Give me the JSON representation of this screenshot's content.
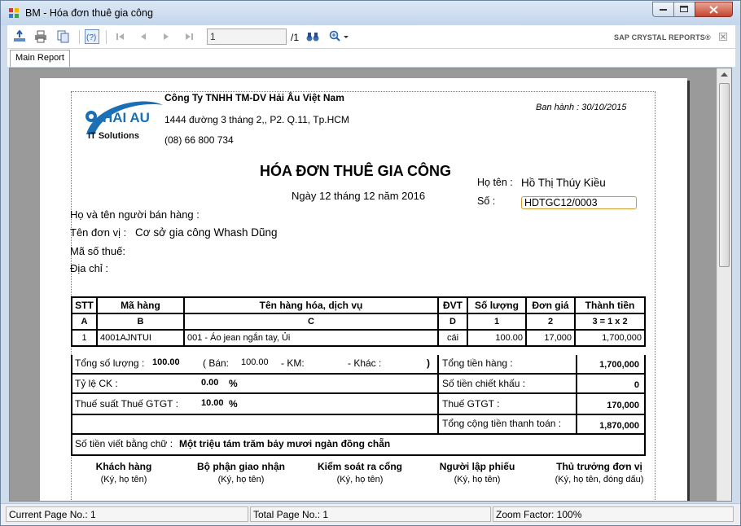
{
  "window": {
    "title": "BM - Hóa đơn thuê gia công"
  },
  "toolbar": {
    "page_value": "1",
    "page_total": "/1",
    "brand": "SAP CRYSTAL REPORTS®"
  },
  "tabs": [
    {
      "label": "Main Report"
    }
  ],
  "report": {
    "company_name": "Công Ty TNHH TM-DV Hải Âu Việt Nam",
    "company_address": "1444 đường 3 tháng 2,, P2. Q.11, Tp.HCM",
    "company_phone": "(08) 66 800 734",
    "logo_text": "HAI AU",
    "logo_sub": "IT Solutions",
    "issued": "Ban hành : 30/10/2015",
    "title": "HÓA ĐƠN THUÊ GIA CÔNG",
    "date": "Ngày 12 tháng 12 năm 2016",
    "name_label": "Họ tên :",
    "name_value": "Hồ Thị Thúy Kiều",
    "no_label": "Số :",
    "no_value": "HDTGC12/0003",
    "seller_label": "Họ và tên người bán hàng :",
    "unit_label": "Tên đơn vị :",
    "unit_value": "Cơ sở gia công Whash Dũng",
    "tax_code_label": "Mã số thuế:",
    "address_label": "Địa chỉ :"
  },
  "table": {
    "headers": [
      "STT",
      "Mã hàng",
      "Tên hàng hóa, dịch vụ",
      "ĐVT",
      "Số lượng",
      "Đơn giá",
      "Thành tiền"
    ],
    "subheaders": [
      "A",
      "B",
      "C",
      "D",
      "1",
      "2",
      "3 = 1 x 2"
    ],
    "rows": [
      [
        "1",
        "4001AJNTUI",
        "001 - Áo jean ngắn tay, Ủi",
        "cái",
        "100.00",
        "17,000",
        "1,700,000"
      ]
    ]
  },
  "summary": {
    "total_qty_label": "Tổng số lượng :",
    "total_qty": "100.00",
    "sale_label": "( Bán:",
    "sale_value": "100.00",
    "km_label": "- KM:",
    "other_label": "- Khác :",
    "close_paren": ")",
    "total_goods_label": "Tổng tiền hàng :",
    "total_goods": "1,700,000",
    "discount_rate_label": "Tỷ lệ CK :",
    "discount_rate": "0.00",
    "percent": "%",
    "discount_amount_label": "Số tiền chiết khấu :",
    "discount_amount": "0",
    "vat_rate_label": "Thuế suất Thuế GTGT :",
    "vat_rate": "10.00",
    "vat_label": "Thuế GTGT :",
    "vat_amount": "170,000",
    "grand_total_label": "Tổng cộng tiền thanh toán :",
    "grand_total": "1,870,000",
    "in_words_label": "Số tiền viết bằng chữ :",
    "in_words": "Một triệu tám trăm bảy mươi ngàn đồng chẵn"
  },
  "signatures": [
    {
      "title": "Khách hàng",
      "sub": "(Ký, họ tên)"
    },
    {
      "title": "Bộ phận giao nhận",
      "sub": "(Ký, họ tên)"
    },
    {
      "title": "Kiểm soát ra cổng",
      "sub": "(Ký, họ tên)"
    },
    {
      "title": "Người lập phiếu",
      "sub": "(Ký, họ tên)"
    },
    {
      "title": "Thủ trưởng đơn vị",
      "sub": "(Ký, họ tên, đóng dấu)"
    }
  ],
  "status": {
    "current_page": "Current Page No.: 1",
    "total_page": "Total Page No.: 1",
    "zoom": "Zoom Factor: 100%"
  },
  "colors": {
    "title_bar": "#c4d6ec",
    "viewport": "#9a9a9a",
    "logo_blue": "#1a6fb5"
  }
}
